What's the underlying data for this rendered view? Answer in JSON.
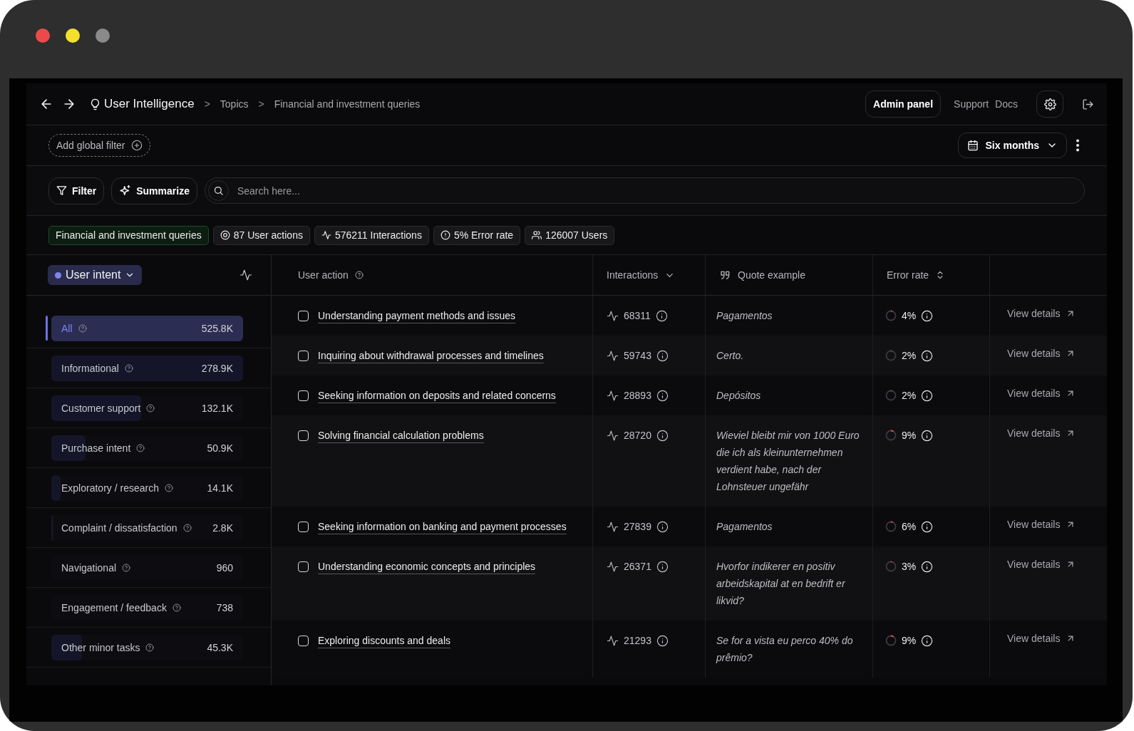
{
  "nav": {
    "title": "User Intelligence",
    "breadcrumbs": [
      {
        "separator": ">",
        "label": "Topics"
      },
      {
        "separator": ">",
        "label": "Financial and investment queries"
      }
    ],
    "admin_button": "Admin panel",
    "links": [
      "Support",
      "Docs"
    ]
  },
  "global_filter": {
    "label": "Add global filter"
  },
  "date_range": {
    "label": "Six months"
  },
  "toolbar": {
    "filter": "Filter",
    "summarize": "Summarize",
    "search": {
      "placeholder": "Search here..."
    }
  },
  "summary_pills": [
    {
      "kind": "topic",
      "label": "Financial and investment queries"
    },
    {
      "kind": "actions",
      "label": "87 User actions"
    },
    {
      "kind": "interactions",
      "label": "576211 Interactions"
    },
    {
      "kind": "error",
      "label": "5% Error rate"
    },
    {
      "kind": "users",
      "label": "126007 Users"
    }
  ],
  "sidebar": {
    "dropdown": {
      "label": "User intent"
    },
    "items": [
      {
        "label": "All",
        "value": "525.8K",
        "level": 1,
        "selected": true
      },
      {
        "label": "Informational",
        "value": "278.9K",
        "level": 1,
        "selected": false
      },
      {
        "label": "Customer support",
        "value": "132.1K",
        "level": 0.47,
        "selected": false
      },
      {
        "label": "Purchase intent",
        "value": "50.9K",
        "level": 0.18,
        "selected": false
      },
      {
        "label": "Exploratory / research",
        "value": "14.1K",
        "level": 0.05,
        "selected": false
      },
      {
        "label": "Complaint / dissatisfaction",
        "value": "2.8K",
        "level": 0.01,
        "selected": false
      },
      {
        "label": "Navigational",
        "value": "960",
        "selected": false
      },
      {
        "label": "Engagement / feedback",
        "value": "738",
        "selected": false
      },
      {
        "label": "Other minor tasks",
        "value": "45.3K",
        "level": 0.16,
        "selected": false
      }
    ]
  },
  "table": {
    "columns": [
      {
        "label": "User action",
        "kind": "help"
      },
      {
        "label": "Interactions",
        "kind": "sort-desc"
      },
      {
        "label": "Quote example",
        "kind": "quote"
      },
      {
        "label": "Error rate",
        "kind": "sort"
      }
    ],
    "rows": [
      {
        "action": "Understanding payment methods and issues",
        "checked": false,
        "interactions": "68311",
        "quote": "Pagamentos",
        "error": {
          "text": "4%",
          "level": 0.04
        },
        "link": "View details"
      },
      {
        "action": "Inquiring about withdrawal processes and timelines",
        "checked": false,
        "interactions": "59743",
        "quote": "Certo.",
        "error": {
          "text": "2%",
          "level": 0.02
        },
        "link": "View details"
      },
      {
        "action": "Seeking information on deposits and related concerns",
        "checked": false,
        "interactions": "28893",
        "quote": "Depósitos",
        "error": {
          "text": "2%",
          "level": 0.02
        },
        "link": "View details"
      },
      {
        "action": "Solving financial calculation problems",
        "checked": false,
        "interactions": "28720",
        "quote": "Wieviel bleibt mir von 1000 Euro die ich als kleinunternehmen verdient habe, nach der Lohnsteuer ungefähr",
        "error": {
          "text": "9%",
          "level": 0.09
        },
        "link": "View details"
      },
      {
        "action": "Seeking information on banking and payment processes",
        "checked": false,
        "interactions": "27839",
        "quote": "Pagamentos",
        "error": {
          "text": "6%",
          "level": 0.06
        },
        "link": "View details"
      },
      {
        "action": "Understanding economic concepts and principles",
        "checked": false,
        "interactions": "26371",
        "quote": "Hvorfor indikerer en positiv arbeidskapital at en bedrift er likvid?",
        "error": {
          "text": "3%",
          "level": 0.03
        },
        "link": "View details"
      },
      {
        "action": "Exploring discounts and deals",
        "checked": false,
        "interactions": "21293",
        "quote": "Se for a vista eu perco 40% do prêmio?",
        "error": {
          "text": "9%",
          "level": 0.09
        },
        "link": "View details"
      }
    ]
  }
}
